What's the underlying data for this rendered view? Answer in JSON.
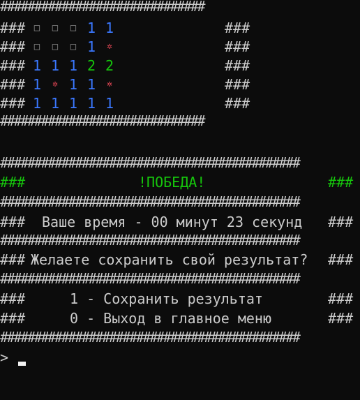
{
  "board": {
    "rows": [
      [
        "empty",
        "empty",
        "empty",
        "1",
        "1"
      ],
      [
        "empty",
        "empty",
        "empty",
        "1",
        "mine"
      ],
      [
        "1",
        "1",
        "1",
        "2",
        "2"
      ],
      [
        "1",
        "mine",
        "1",
        "1",
        "mine"
      ],
      [
        "1",
        "1",
        "1",
        "1",
        "1"
      ]
    ],
    "glyphs": {
      "empty": "□",
      "mine": "✲",
      "1": "1",
      "2": "2"
    },
    "border_top": "##############################",
    "border_bottom": "##############################",
    "side_left": "###",
    "side_right": "###"
  },
  "panel": {
    "bar": "############################################",
    "side": "###",
    "victory_text": "!ПОБЕДА!",
    "time_text": "Ваше время - 00 минут 23 секунд",
    "save_prompt": "Желаете сохранить свой результат?",
    "option_save": "1 - Сохранить результат",
    "option_exit": "0 - Выход в главное меню"
  },
  "prompt": {
    "symbol": ">"
  },
  "colors": {
    "background": "#0c0c0c",
    "text": "#cccccc",
    "green": "#16c60c",
    "blue": "#3b78ff",
    "red": "#e74856"
  }
}
